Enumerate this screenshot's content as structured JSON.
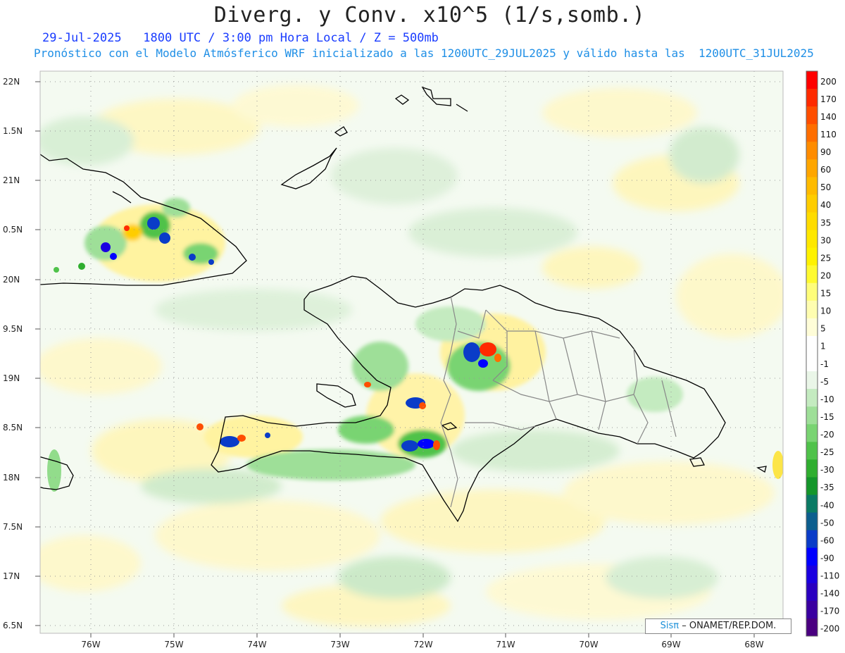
{
  "map": {
    "title": "Diverg. y Conv. x10^5 (1/s,somb.)",
    "subtitle_line1": "29-Jul-2025   1800 UTC / 3:00 pm Hora Local / Z = 500mb",
    "subtitle_line2": "Pronóstico con el Modelo Atmósferico WRF inicializado a las 1200UTC_29JUL2025 y válido hasta las  1200UTC_31JUL2025",
    "lat_labels": [
      "22N",
      "1.5N",
      "21N",
      "0.5N",
      "20N",
      "9.5N",
      "19N",
      "8.5N",
      "18N",
      "7.5N",
      "17N",
      "6.5N"
    ],
    "lon_labels": [
      "76W",
      "75W",
      "74W",
      "73W",
      "72W",
      "71W",
      "70W",
      "69W",
      "68W"
    ],
    "credit_sis": "Sisπ",
    "credit_text": "– ONAMET/REP.DOM.",
    "colorbar": {
      "labels": [
        "200",
        "170",
        "140",
        "110",
        "90",
        "60",
        "50",
        "40",
        "35",
        "30",
        "25",
        "20",
        "15",
        "10",
        "5",
        "1",
        "-1",
        "-5",
        "-10",
        "-15",
        "-20",
        "-25",
        "-30",
        "-35",
        "-40",
        "-50",
        "-60",
        "-90",
        "-110",
        "-140",
        "-170",
        "-200"
      ],
      "colors": [
        "#ff0000",
        "#ff2a00",
        "#ff4e00",
        "#ff6e00",
        "#ff8c00",
        "#ffa600",
        "#ffbb00",
        "#ffcd00",
        "#ffdc00",
        "#ffe800",
        "#fff200",
        "#fffa30",
        "#fffd7a",
        "#fffdb0",
        "#fffdd8",
        "#ffffff",
        "#ffffff",
        "#eaf6e8",
        "#c4ebc0",
        "#9edf98",
        "#79d472",
        "#4fc24a",
        "#2fae2f",
        "#14962a",
        "#0a7a64",
        "#0c5e8e",
        "#0a3cc8",
        "#0000ff",
        "#1a00e0",
        "#2a00c0",
        "#3a00a0",
        "#4a0080"
      ]
    },
    "features": [
      "hispaniola-coast",
      "cuba-coast",
      "bahamas-islands",
      "jamaica-coast",
      "inagua-islands",
      "provincial-borders"
    ]
  }
}
